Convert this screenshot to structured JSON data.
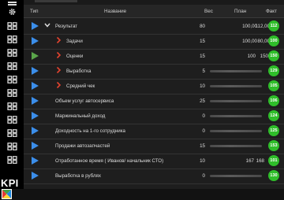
{
  "colors": {
    "expand_arrow": "#3b8eea",
    "priority_arrow_red": "#e0432f",
    "priority_arrow_green": "#5aa54a",
    "badge_green": "#2fbe2a"
  },
  "sidebar": {
    "icons": [
      "settings-icon",
      "gear-icon",
      "grid-icon",
      "grid-icon",
      "grid-icon",
      "grid-icon",
      "grid-icon",
      "grid-icon",
      "grid-icon",
      "grid-icon",
      "grid-icon",
      "grid-icon"
    ],
    "logo_text": "KPI"
  },
  "table": {
    "headers": {
      "type": "Тип",
      "name": "Название",
      "weight": "Вес",
      "plan": "План",
      "fact": "Факт"
    },
    "rows": [
      {
        "name": "Результат",
        "weight": "80",
        "plan": "100,00",
        "fact": "112,00",
        "score": "112"
      },
      {
        "name": "Задачи",
        "weight": "15",
        "plan": "100,00",
        "fact": "80,00",
        "score": "100"
      },
      {
        "name": "Оценки",
        "weight": "15",
        "plan": "100",
        "fact": "150",
        "score": "150"
      },
      {
        "name": "Выработка",
        "weight": "5",
        "plan": "",
        "fact": "",
        "score": "129"
      },
      {
        "name": "Средний чек",
        "weight": "10",
        "plan": "",
        "fact": "",
        "score": "105"
      },
      {
        "name": "Объем услуг автосервиса",
        "weight": "25",
        "plan": "",
        "fact": "",
        "score": "106"
      },
      {
        "name": "Маржинальный доход",
        "weight": "0",
        "plan": "",
        "fact": "",
        "score": "124"
      },
      {
        "name": "Доходность на 1-го сотрудника",
        "weight": "0",
        "plan": "",
        "fact": "",
        "score": "125"
      },
      {
        "name": "Продажи автозапчастей",
        "weight": "15",
        "plan": "",
        "fact": "",
        "score": "153"
      },
      {
        "name": "Отработанное время ( Иванов/ начальник СТО)",
        "weight": "10",
        "plan": "167",
        "fact": "168",
        "score": "101"
      },
      {
        "name": "Выработка в рублях",
        "weight": "0",
        "plan": "",
        "fact": "",
        "score": "130"
      }
    ]
  }
}
